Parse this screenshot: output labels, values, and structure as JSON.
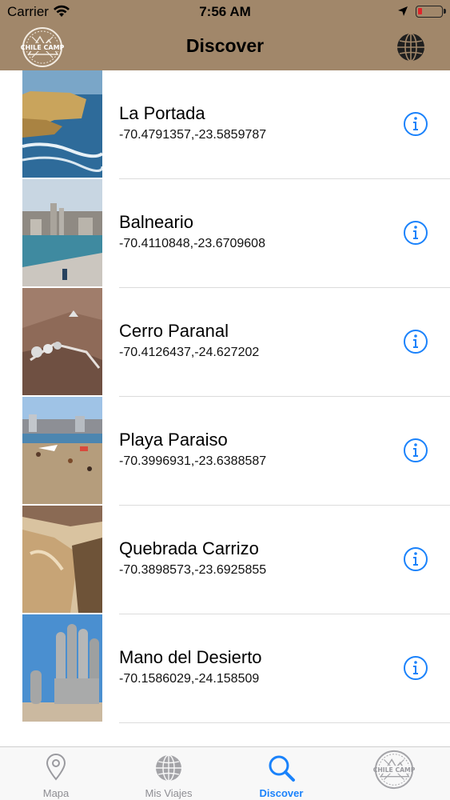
{
  "status_bar": {
    "carrier": "Carrier",
    "time": "7:56 AM",
    "battery_color": "#e0242a"
  },
  "nav": {
    "title": "Discover",
    "logo_text": "CHILE CAMP",
    "right_icon": "globe-icon",
    "background": "#a1876a"
  },
  "places": [
    {
      "name": "La Portada",
      "coords": "-70.4791357,-23.5859787"
    },
    {
      "name": "Balneario",
      "coords": "-70.4110848,-23.6709608"
    },
    {
      "name": "Cerro Paranal",
      "coords": "-70.4126437,-24.627202"
    },
    {
      "name": "Playa Paraiso",
      "coords": "-70.3996931,-23.6388587"
    },
    {
      "name": "Quebrada Carrizo",
      "coords": "-70.3898573,-23.6925855"
    },
    {
      "name": "Mano del Desierto",
      "coords": "-70.1586029,-24.158509"
    }
  ],
  "tabs": [
    {
      "label": "Mapa",
      "icon": "map-pin-icon",
      "active": false
    },
    {
      "label": "Mis Viajes",
      "icon": "globe-icon",
      "active": false
    },
    {
      "label": "Discover",
      "icon": "search-icon",
      "active": true
    },
    {
      "label": "",
      "icon": "chile-camp-logo-icon",
      "active": false
    }
  ],
  "tab_logo_text": "CHILE CAMP",
  "accent_color": "#1a82fb"
}
